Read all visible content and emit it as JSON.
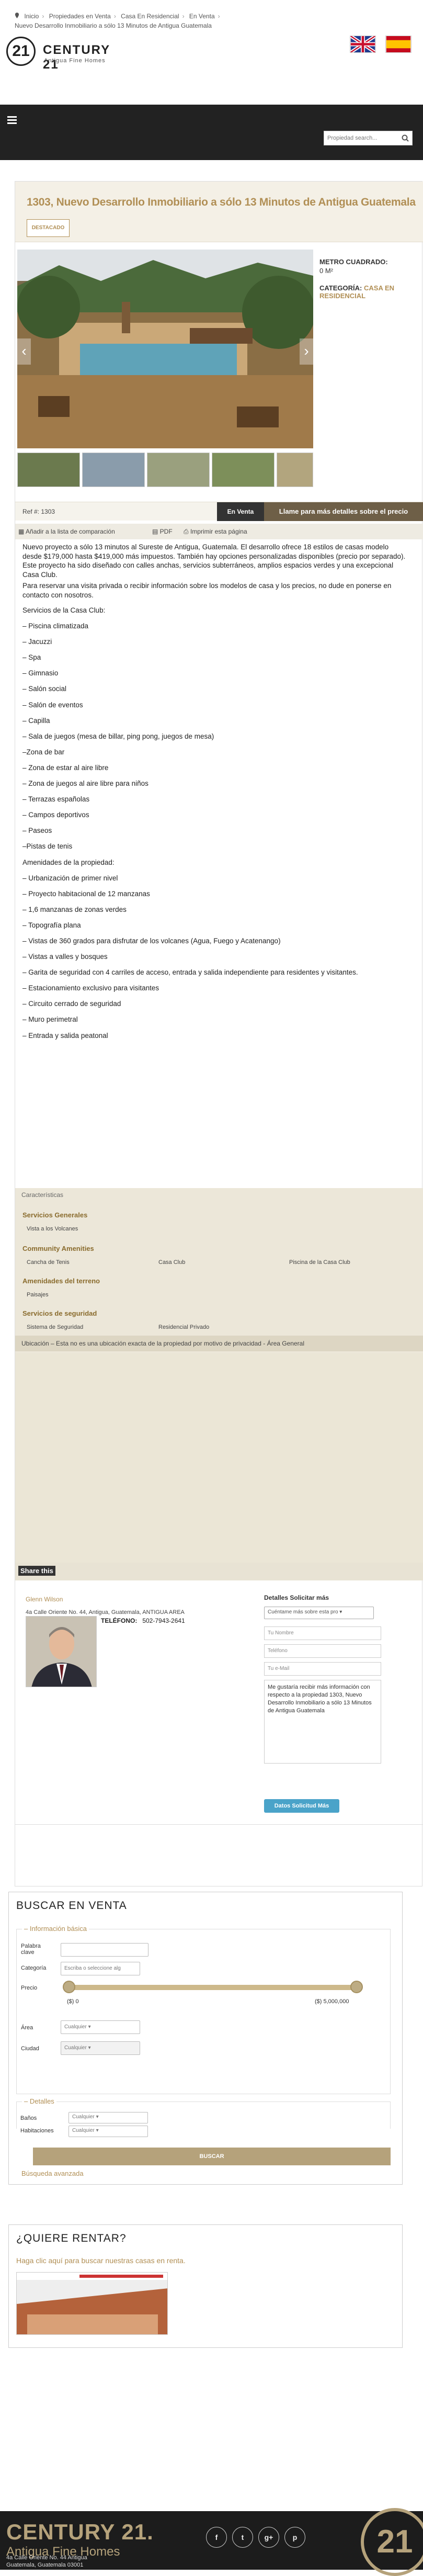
{
  "breadcrumb": {
    "items": [
      "Inicio",
      "Propiedades en Venta",
      "Casa En Residencial",
      "En Venta"
    ],
    "current": "Nuevo Desarrollo Inmobiliario a sólo 13 Minutos de Antigua Guatemala"
  },
  "logo": {
    "brand": "CENTURY 21",
    "sub": "Antigua Fine Homes",
    "mark": "21"
  },
  "search": {
    "placeholder": "Propiedad search..."
  },
  "property": {
    "title": "1303, Nuevo Desarrollo Inmobiliario a sólo 13 Minutos de Antigua Guatemala",
    "badge": "DESTACADO",
    "metro_label": "METRO CUADRADO:",
    "metro_value": "0 M²",
    "categoria_label": "CATEGORÍA:",
    "categoria_value": "CASA EN RESIDENCIAL",
    "ref": "Ref #: 1303",
    "status": "En Venta",
    "call": "Llame para más detalles sobre el precio"
  },
  "tools": {
    "compare": "Añadir a la lista de comparación",
    "pdf": "PDF",
    "print": "Imprimir esta página"
  },
  "description": {
    "intro": "Nuevo proyecto a sólo 13 minutos al Sureste de Antigua, Guatemala. El desarrollo ofrece 18 estilos de casas modelo desde $179,000 hasta $419,000 más impuestos. También hay opciones personalizadas disponibles (precio por separado). Este proyecto ha sido diseñado con calles anchas, servicios subterráneos, amplios espacios verdes y una excepcional Casa Club.",
    "intro2": "Para reservar una visita privada o recibir información sobre los modelos de casa y los precios, no dude en ponerse en contacto con nosotros.",
    "club_heading": "Servicios de la Casa Club:",
    "club": [
      "– Piscina climatizada",
      "– Jacuzzi",
      "– Spa",
      "– Gimnasio",
      "– Salón social",
      "– Salón de eventos",
      "– Capilla",
      "– Sala de juegos (mesa de billar, ping pong, juegos de mesa)",
      "–Zona de bar",
      "– Zona de estar al aire libre",
      "– Zona de juegos al aire libre para niños",
      "– Terrazas españolas",
      "– Campos deportivos",
      "– Paseos",
      "–Pistas de tenis"
    ],
    "amen_heading": "Amenidades de la propiedad:",
    "amen": [
      "– Urbanización de primer nivel",
      "– Proyecto habitacional de 12 manzanas",
      "– 1,6 manzanas de zonas verdes",
      "– Topografía plana",
      "– Vistas de 360 grados para disfrutar de los volcanes (Agua, Fuego y Acatenango)",
      "– Vistas a valles y bosques",
      "– Garita de seguridad con 4 carriles de acceso, entrada y salida independiente para residentes y visitantes.",
      "– Estacionamiento exclusivo para visitantes",
      "– Circuito cerrado de seguridad",
      "– Muro perimetral",
      "– Entrada y salida peatonal"
    ]
  },
  "characteristics": {
    "heading": "Características",
    "sections": [
      {
        "title": "Servicios Generales",
        "items": [
          "Vista a los Volcanes"
        ]
      },
      {
        "title": "Community Amenities",
        "items": [
          "Cancha de Tenis",
          "Casa Club",
          "Piscina de la Casa Club"
        ]
      },
      {
        "title": "Amenidades del terreno",
        "items": [
          "Paisajes"
        ]
      },
      {
        "title": "Servicios de seguridad",
        "items": [
          "Sistema de Seguridad",
          "Residencial Privado"
        ]
      }
    ]
  },
  "location_note": "Ubicación – Esta no es una ubicación exacta de la propiedad por motivo de privacidad - Área General",
  "share": "Share this",
  "agent": {
    "name": "Glenn Wilson",
    "address": "4a Calle Oriente No. 44, Antigua, Guatemala, ANTIGUA AREA",
    "tel_label": "TELÉFONO:",
    "tel": "502-7943-2641"
  },
  "contact_form": {
    "title": "Detalles Solicitar más",
    "select": "Cuéntame más sobre esta pro",
    "name_ph": "Tu Nombre",
    "phone_ph": "Teléfono",
    "email_ph": "Tu e-Mail",
    "message": "Me gustaría recibir más información con respecto a la propiedad 1303, Nuevo Desarrollo Inmobiliario a sólo 13 Minutos de Antigua Guatemala",
    "button": "Datos Solicitud Más"
  },
  "buscar": {
    "title": "BUSCAR EN VENTA",
    "basic_legend": "– Información básica",
    "keyword_label": "Palabra clave",
    "category_label": "Categoría",
    "category_ph": "Escriba o seleccione alg",
    "price_label": "Precio",
    "price_min": "($) 0",
    "price_max": "($) 5,000,000",
    "area_label": "Área",
    "area_value": "Cualquier",
    "city_label": "Ciudad",
    "city_value": "Cualquier",
    "details_legend": "– Detalles",
    "banos_label": "Baños",
    "banos_value": "Cualquier",
    "hab_label": "Habitaciones",
    "hab_value": "Cualquier",
    "button": "BUSCAR",
    "advanced": "Búsqueda avanzada"
  },
  "rentar": {
    "title": "¿QUIERE RENTAR?",
    "link": "Haga clic aquí para buscar nuestras casas en renta."
  },
  "footer": {
    "brand": "CENTURY 21.",
    "sub": "Antigua Fine Homes",
    "address1": "4a Calle Oriente No. 44 Antigua",
    "address2": "Guatemala, Guatemala 03001",
    "socials": [
      "f",
      "t",
      "g+",
      "p"
    ],
    "mark": "21"
  },
  "colors": {
    "accent": "#b18f55",
    "dark": "#222222",
    "beige": "#ece7d9"
  }
}
